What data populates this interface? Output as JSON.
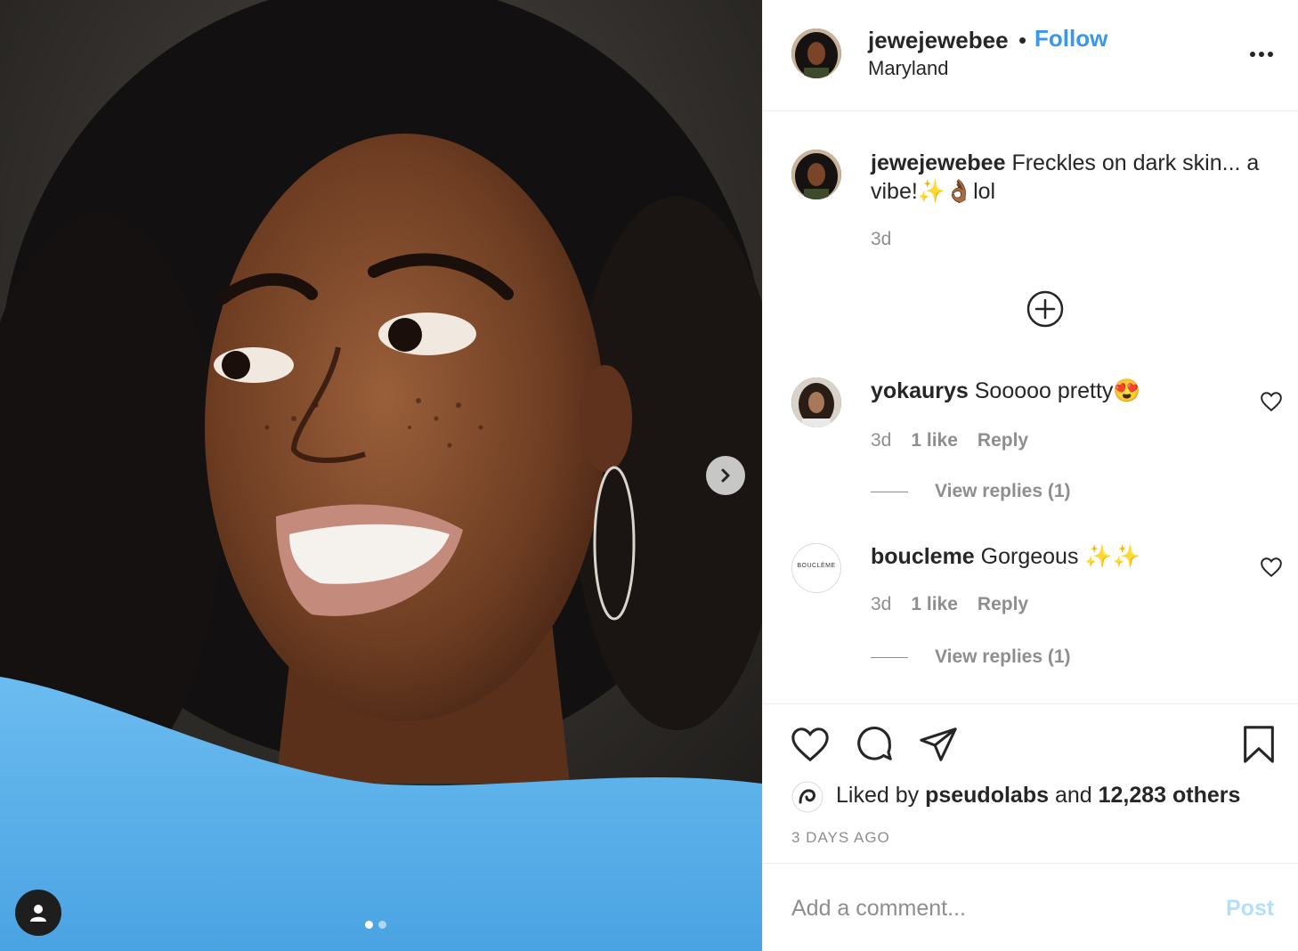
{
  "post": {
    "author": "jewejewebee",
    "follow_label": "Follow",
    "separator": "•",
    "location": "Maryland",
    "caption_user": "jewejewebee",
    "caption_text": "Freckles on dark skin... a vibe!✨👌🏾lol",
    "caption_time": "3d"
  },
  "comments": [
    {
      "user": "yokaurys",
      "text": "Sooooo pretty😍",
      "time": "3d",
      "likes": "1 like",
      "reply_label": "Reply",
      "view_replies": "View replies (1)"
    },
    {
      "user": "boucleme",
      "text": "Gorgeous ✨✨",
      "time": "3d",
      "likes": "1 like",
      "reply_label": "Reply",
      "view_replies": "View replies (1)",
      "avatar_text": "BOUCLÈME"
    }
  ],
  "engagement": {
    "liked_by_prefix": "Liked by",
    "liked_by_user": "pseudolabs",
    "liked_by_and": "and",
    "liked_by_others": "12,283 others",
    "posted_ago": "3 DAYS AGO"
  },
  "comment_box": {
    "placeholder": "Add a comment...",
    "post_label": "Post"
  },
  "carousel": {
    "slide_count": 2,
    "active_index": 0
  },
  "colors": {
    "link_blue": "#3897f0",
    "post_disabled": "#b2dffc",
    "muted_text": "#8e8e8e",
    "divider": "#efefef"
  },
  "icons": {
    "like": "heart-icon",
    "comment": "comment-icon",
    "share": "paper-plane-icon",
    "save": "bookmark-icon",
    "more": "more-options-icon",
    "add": "plus-circle-icon",
    "next": "chevron-right-icon",
    "tag": "user-tag-icon"
  }
}
